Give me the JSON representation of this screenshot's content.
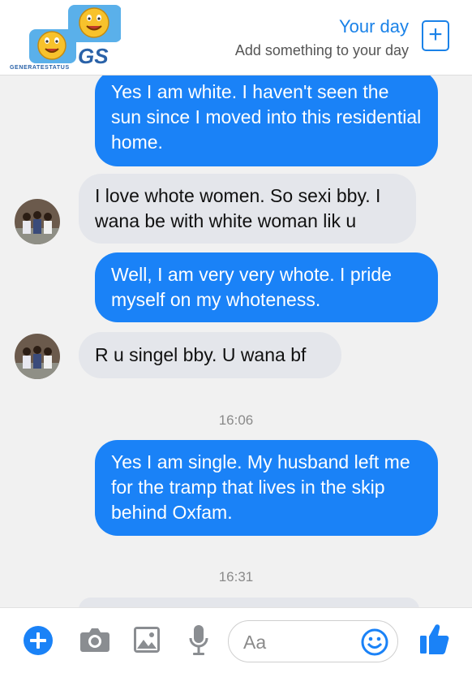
{
  "header": {
    "logo_text": "GS",
    "logo_caption": "GENERATESTATUS",
    "your_day_title": "Your day",
    "your_day_subtitle": "Add something to your day",
    "add_icon": "plus-square-icon"
  },
  "messages": [
    {
      "direction": "out",
      "text": "Yes I am white. I haven't seen the sun since I moved into this residential home."
    },
    {
      "direction": "in",
      "text": "I love whote women. So sexi bby. I wana be with white woman lik u"
    },
    {
      "direction": "out",
      "text": "Well, I am very very whote. I pride myself on my whoteness."
    },
    {
      "direction": "in",
      "text": "R u singel bby. U wana bf"
    },
    {
      "direction": "out",
      "text": "Yes I am single. My husband left me for the tramp that lives in the skip behind Oxfam."
    }
  ],
  "timestamps": [
    "16:06",
    "16:31"
  ],
  "composer": {
    "placeholder": "Aa",
    "icons": [
      "plus-icon",
      "camera-icon",
      "image-icon",
      "microphone-icon",
      "emoji-icon",
      "thumbs-up-icon"
    ]
  },
  "colors": {
    "accent": "#1a82f7",
    "outgoing_bubble": "#1a82f7",
    "incoming_bubble": "#e4e6eb",
    "background": "#f1f1f1"
  }
}
